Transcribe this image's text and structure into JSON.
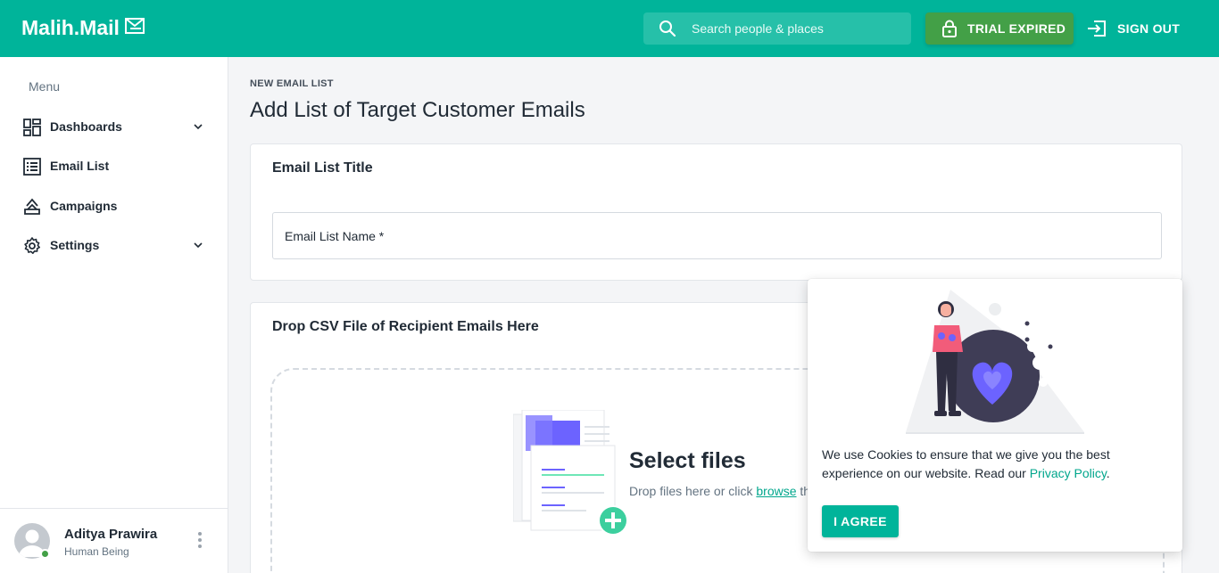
{
  "header": {
    "brand": "Malih.Mail",
    "search_placeholder": "Search people & places",
    "trial_label": "TRIAL EXPIRED",
    "signout_label": "SIGN OUT"
  },
  "sidebar": {
    "menu_title": "Menu",
    "items": [
      {
        "label": "Dashboards",
        "icon": "dashboard-icon",
        "has_submenu": true
      },
      {
        "label": "Email List",
        "icon": "list-icon",
        "has_submenu": false
      },
      {
        "label": "Campaigns",
        "icon": "campaign-icon",
        "has_submenu": false
      },
      {
        "label": "Settings",
        "icon": "gear-icon",
        "has_submenu": true
      }
    ],
    "user": {
      "name": "Aditya Prawira",
      "role": "Human Being",
      "status_color": "#43a047"
    }
  },
  "main": {
    "eyebrow": "NEW EMAIL LIST",
    "title": "Add List of Target Customer Emails",
    "title_card": {
      "heading": "Email List Title",
      "field_label": "Email List Name *",
      "field_value": ""
    },
    "upload_card": {
      "heading": "Drop CSV File of Recipient Emails Here",
      "select_title": "Select files",
      "select_prefix": "Drop files here or click ",
      "browse_label": "browse",
      "select_suffix": " th"
    }
  },
  "cookie": {
    "text": "We use Cookies to ensure that we give you the best experience on our website. Read our ",
    "link": "Privacy Policy",
    "end": ".",
    "button": "I AGREE"
  },
  "colors": {
    "primary": "#00b49a",
    "trial": "#43a047",
    "illustration": "#6c63ff"
  }
}
